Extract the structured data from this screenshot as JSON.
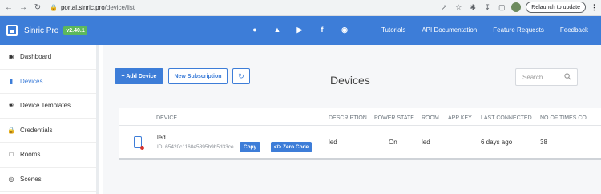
{
  "browser": {
    "url_host": "portal.sinric.pro",
    "url_path": "/device/list",
    "relaunch_label": "Relaunch to update"
  },
  "header": {
    "brand": "Sinric Pro",
    "version": "v2.40.1",
    "social_icons": [
      "apple-icon",
      "android-icon",
      "youtube-icon",
      "facebook-icon",
      "github-icon"
    ],
    "links": [
      "Tutorials",
      "API Documentation",
      "Feature Requests",
      "Feedback"
    ]
  },
  "sidebar": {
    "items": [
      {
        "label": "Dashboard",
        "icon": "dashboard-icon"
      },
      {
        "label": "Devices",
        "icon": "device-icon",
        "active": true
      },
      {
        "label": "Device Templates",
        "icon": "device-templates-icon"
      },
      {
        "label": "Credentials",
        "icon": "lock-icon"
      },
      {
        "label": "Rooms",
        "icon": "rooms-icon"
      },
      {
        "label": "Scenes",
        "icon": "scenes-icon"
      }
    ]
  },
  "toolbar": {
    "add_label": "+ Add Device",
    "subscription_label": "New Subscription",
    "title": "Devices",
    "search_placeholder": "Search..."
  },
  "table": {
    "columns": [
      "DEVICE",
      "DESCRIPTION",
      "POWER STATE",
      "ROOM",
      "APP KEY",
      "LAST CONNECTED",
      "NO OF TIMES CO"
    ],
    "rows": [
      {
        "name": "led",
        "id": "ID: 65420c1160e5895b9b5d33ce",
        "copy_label": "Copy",
        "zero_code_label": "</> Zero Code",
        "description": "led",
        "power_state": "On",
        "room": "led",
        "app_key": "",
        "last_connected": "6 days ago",
        "times_connected": "38"
      }
    ]
  },
  "colors": {
    "accent": "#3d7dd8",
    "version_badge": "#5cb85c",
    "status_dot": "#d9312b"
  }
}
